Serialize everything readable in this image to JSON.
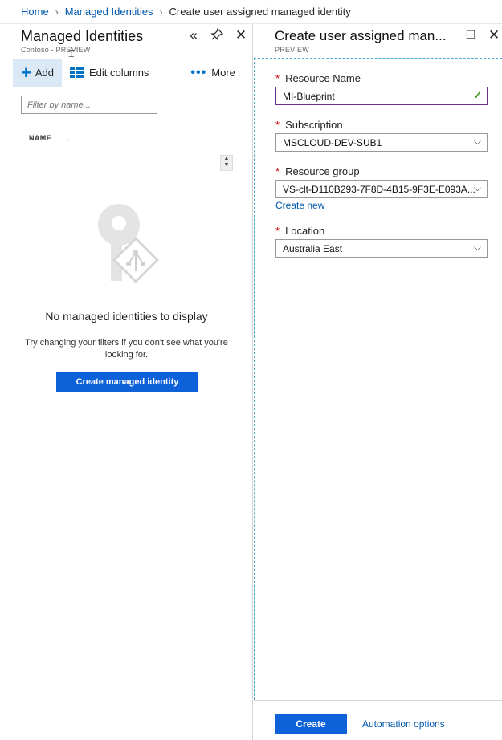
{
  "breadcrumb": {
    "items": [
      "Home",
      "Managed Identities",
      "Create user assigned managed identity"
    ]
  },
  "left_blade": {
    "title": "Managed Identities",
    "subtitle": "Contoso - PREVIEW",
    "controls": [
      "collapse-icon",
      "pin-icon",
      "close-icon"
    ],
    "toolbar": {
      "add": "Add",
      "edit_columns": "Edit columns",
      "more": "More"
    },
    "filter_placeholder": "Filter by name...",
    "column_header": "NAME",
    "empty_title": "No managed identities to display",
    "empty_hint": "Try changing your filters if you don't see what you're looking for.",
    "create_button": "Create managed identity"
  },
  "right_blade": {
    "title": "Create user assigned man...",
    "subtitle": "PREVIEW",
    "controls": [
      "maximize-icon",
      "close-icon"
    ],
    "fields": {
      "resource_name": {
        "label": "Resource Name",
        "value": "MI-Blueprint",
        "valid": true
      },
      "subscription": {
        "label": "Subscription",
        "value": "MSCLOUD-DEV-SUB1"
      },
      "resource_group": {
        "label": "Resource group",
        "value": "VS-clt-D110B293-7F8D-4B15-9F3E-E093A...",
        "create_new": "Create new"
      },
      "location": {
        "label": "Location",
        "value": "Australia East"
      }
    },
    "required_mark": "*",
    "footer": {
      "create": "Create",
      "automation": "Automation options"
    }
  },
  "colors": {
    "accent": "#0e62d9",
    "link": "#0058ad",
    "required": "#cc0000",
    "valid": "#3a9d1a",
    "active_border": "#6a2c91"
  }
}
